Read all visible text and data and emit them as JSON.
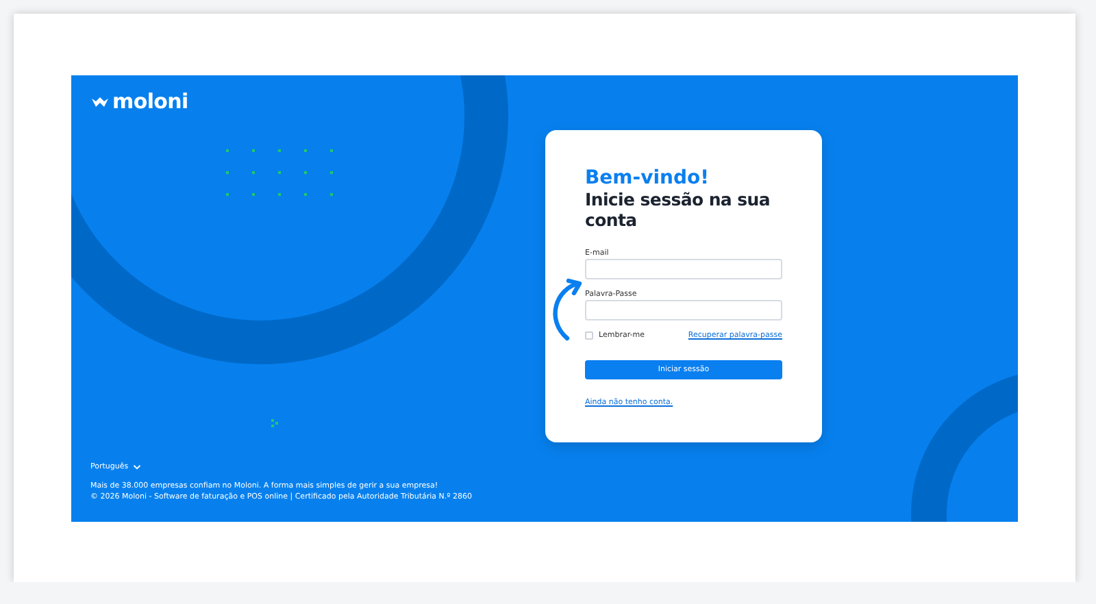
{
  "brand": {
    "logo_text": "moloni"
  },
  "language": {
    "label": "Português"
  },
  "footer": {
    "tagline": "Mais de 38.000 empresas confiam no Moloni. A forma mais simples de gerir a sua empresa!",
    "copyright": "© 2026 Moloni - Software de faturação e POS online | Certificado pela Autoridade Tributária N.º 2860"
  },
  "login": {
    "welcome": "Bem-vindo!",
    "heading": "Inicie sessão na sua conta",
    "fields": [
      {
        "label": "E-mail"
      },
      {
        "label": "Palavra-Passe"
      }
    ],
    "remember": {
      "label": "Lembrar-me",
      "checked": false
    },
    "recover_link": "Recuperar palavra-passe",
    "submit": "Iniciar sessão",
    "signup_link": "Ainda não tenho conta."
  }
}
